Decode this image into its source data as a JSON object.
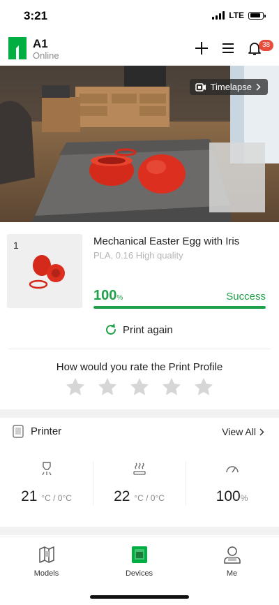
{
  "status_bar": {
    "time": "3:21",
    "network": "LTE"
  },
  "header": {
    "device_name": "A1",
    "device_status": "Online",
    "notification_count": "38",
    "icons": [
      "add-icon",
      "menu-icon",
      "bell-icon"
    ]
  },
  "camera": {
    "timelapse_label": "Timelapse"
  },
  "print_job": {
    "plate_number": "1",
    "title": "Mechanical Easter Egg with Iris",
    "subtitle": "PLA, 0.16 High quality",
    "progress_value": "100",
    "progress_unit": "%",
    "progress_fraction": 1.0,
    "status": "Success",
    "print_again_label": "Print again",
    "accent_color": "#21a04a"
  },
  "rating": {
    "question": "How would you rate the Print Profile",
    "stars_total": 5,
    "stars_selected": 0
  },
  "printer": {
    "section_title": "Printer",
    "view_all_label": "View All",
    "stats": [
      {
        "icon": "nozzle-icon",
        "value": "21",
        "unit": "°C / 0°C"
      },
      {
        "icon": "heatbed-icon",
        "value": "22",
        "unit": "°C / 0°C"
      },
      {
        "icon": "speed-gauge-icon",
        "value": "100",
        "unit": "%"
      }
    ]
  },
  "tabs": [
    {
      "label": "Models",
      "icon": "models-icon",
      "active": false
    },
    {
      "label": "Devices",
      "icon": "devices-icon",
      "active": true
    },
    {
      "label": "Me",
      "icon": "profile-icon",
      "active": false
    }
  ]
}
